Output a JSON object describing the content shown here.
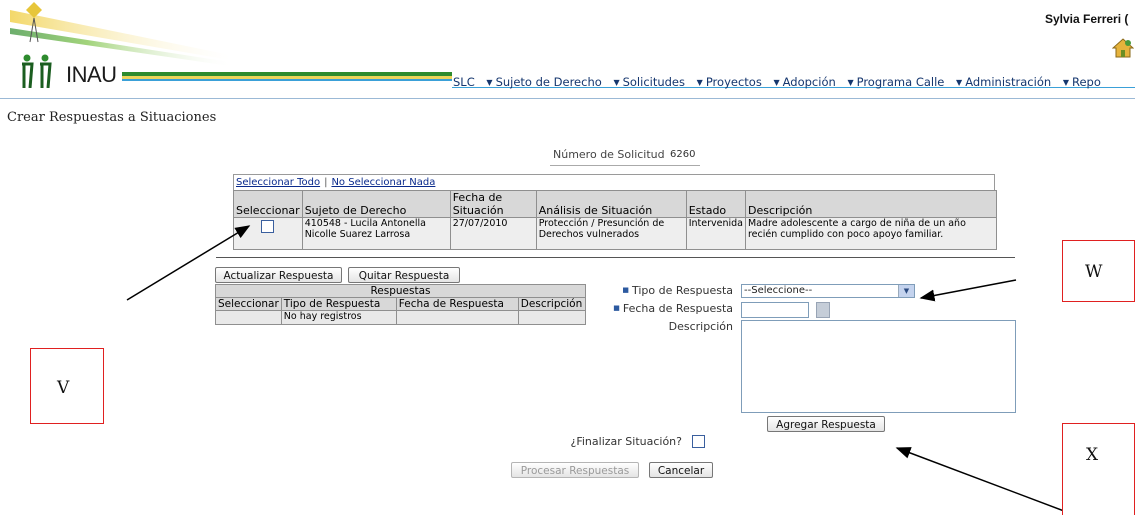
{
  "header": {
    "brand": "INAU",
    "user_name": "Sylvia Ferreri (",
    "nav": [
      "SLC",
      "Sujeto de Derecho",
      "Solicitudes",
      "Proyectos",
      "Adopción",
      "Programa Calle",
      "Administración",
      "Repo"
    ]
  },
  "page": {
    "title": "Crear Respuestas a Situaciones",
    "request_label": "Número de Solicitud",
    "request_number": "6260"
  },
  "situations": {
    "select_all": "Seleccionar Todo",
    "select_none": "No Seleccionar Nada",
    "separator": "|",
    "headers": [
      "Seleccionar",
      "Sujeto de Derecho",
      "Fecha de Situación",
      "Análisis de Situación",
      "Estado",
      "Descripción"
    ],
    "rows": [
      {
        "subject": "410548 - Lucila Antonella Nicolle Suarez Larrosa",
        "date": "27/07/2010",
        "analysis": "Protección / Presunción de Derechos vulnerados",
        "status": "Intervenida",
        "description": "Madre adolescente a cargo de niña de un año recién cumplido con poco apoyo familiar."
      }
    ]
  },
  "responses": {
    "update_button": "Actualizar Respuesta",
    "remove_button": "Quitar Respuesta",
    "caption": "Respuestas",
    "headers": [
      "Seleccionar",
      "Tipo de Respuesta",
      "Fecha de Respuesta",
      "Descripción"
    ],
    "empty_text": "No hay registros"
  },
  "form": {
    "type_label": "Tipo de Respuesta",
    "type_value": "--Seleccione--",
    "date_label": "Fecha de Respuesta",
    "date_value": "",
    "desc_label": "Descripción",
    "add_button": "Agregar Respuesta",
    "finalize_label": "¿Finalizar Situación?",
    "process_button": "Procesar Respuestas",
    "cancel_button": "Cancelar"
  },
  "annotations": {
    "v": "V",
    "w": "W",
    "x": "X"
  },
  "colors": {
    "nav_text": "#15366e",
    "annotation_border": "#e02020",
    "required_marker": "#2c5aa0"
  }
}
